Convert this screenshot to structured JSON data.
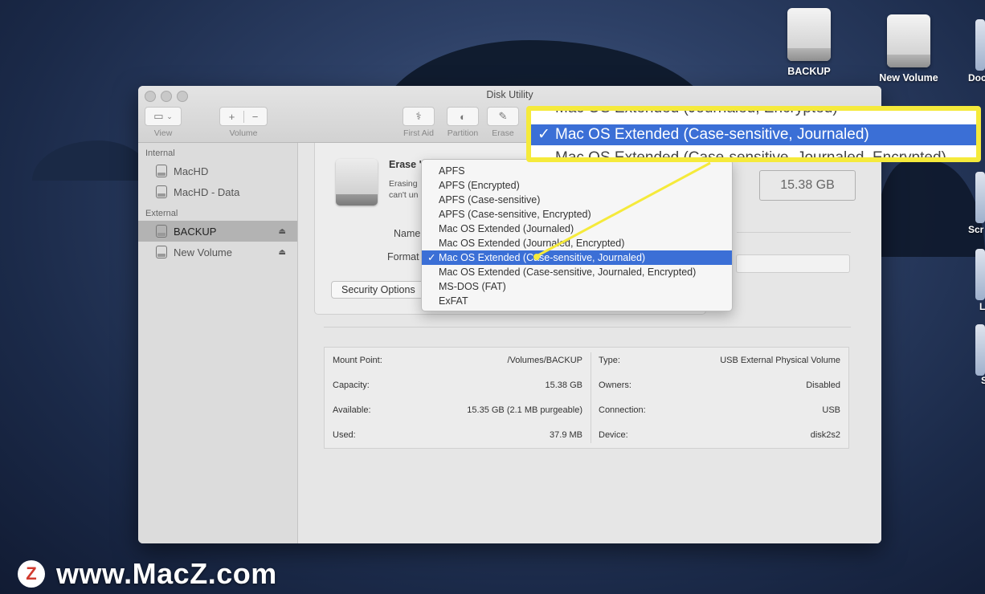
{
  "desktop": {
    "icons": [
      {
        "label": "BACKUP"
      },
      {
        "label": "New Volume"
      }
    ],
    "edge_labels": [
      "Doc",
      "Scr",
      "L",
      "S"
    ]
  },
  "window": {
    "title": "Disk Utility",
    "toolbar": {
      "view_label": "View",
      "volume_label": "Volume",
      "first_aid_label": "First Aid",
      "partition_label": "Partition",
      "erase_label": "Erase",
      "add_symbol": "+",
      "remove_symbol": "−"
    }
  },
  "sidebar": {
    "internal_header": "Internal",
    "internal_items": [
      "MacHD",
      "MacHD - Data"
    ],
    "external_header": "External",
    "external_items": [
      "BACKUP",
      "New Volume"
    ],
    "selected": "BACKUP"
  },
  "erase_sheet": {
    "title": "Erase \"",
    "description_line1": "Erasing",
    "description_line2": "can't un",
    "name_label": "Name",
    "format_label": "Format",
    "security_options_label": "Security Options"
  },
  "capacity_display": "15.38 GB",
  "format_menu": {
    "options": [
      "APFS",
      "APFS (Encrypted)",
      "APFS (Case-sensitive)",
      "APFS (Case-sensitive, Encrypted)",
      "Mac OS Extended (Journaled)",
      "Mac OS Extended (Journaled, Encrypted)",
      "Mac OS Extended (Case-sensitive, Journaled)",
      "Mac OS Extended (Case-sensitive, Journaled, Encrypted)",
      "MS-DOS (FAT)",
      "ExFAT"
    ],
    "selected": "Mac OS Extended (Case-sensitive, Journaled)",
    "check_mark": "✓"
  },
  "callout": {
    "above": "Mac OS Extended (Journaled, Encrypted)",
    "selected": "Mac OS Extended (Case-sensitive, Journaled)",
    "below": "Mac OS Extended (Case-sensitive, Journaled, Encrypted)",
    "check_mark": "✓",
    "highlight_color": "#f5ea3b"
  },
  "info": {
    "left": [
      {
        "key": "Mount Point:",
        "value": "/Volumes/BACKUP"
      },
      {
        "key": "Capacity:",
        "value": "15.38 GB"
      },
      {
        "key": "Available:",
        "value": "15.35 GB (2.1 MB purgeable)"
      },
      {
        "key": "Used:",
        "value": "37.9 MB"
      }
    ],
    "right": [
      {
        "key": "Type:",
        "value": "USB External Physical Volume"
      },
      {
        "key": "Owners:",
        "value": "Disabled"
      },
      {
        "key": "Connection:",
        "value": "USB"
      },
      {
        "key": "Device:",
        "value": "disk2s2"
      }
    ]
  },
  "watermark": {
    "logo_letter": "Z",
    "text": "www.MacZ.com"
  },
  "colors": {
    "selection_blue": "#3b6fd6",
    "callout_yellow": "#f5ea3b"
  }
}
